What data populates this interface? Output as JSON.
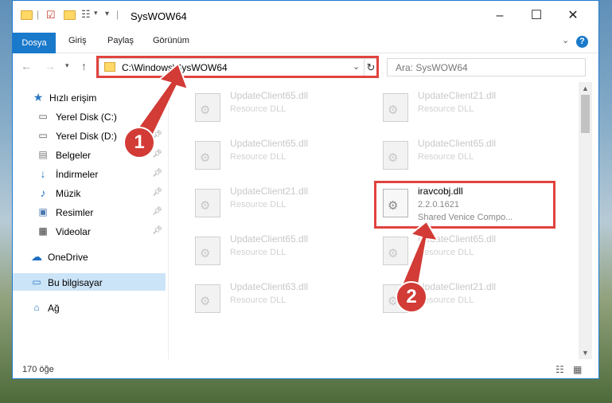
{
  "window": {
    "title": "SysWOW64"
  },
  "ribbon": {
    "tabs": [
      "Dosya",
      "Giriş",
      "Paylaş",
      "Görünüm"
    ]
  },
  "address": {
    "path": "C:\\Windows\\SysWOW64"
  },
  "search": {
    "placeholder": "Ara: SysWOW64"
  },
  "sidebar": {
    "quick_access": "Hızlı erişim",
    "items": [
      "Yerel Disk (C:)",
      "Yerel Disk (D:)",
      "Belgeler",
      "İndirmeler",
      "Müzik",
      "Resimler",
      "Videolar"
    ],
    "onedrive": "OneDrive",
    "this_pc": "Bu bilgisayar",
    "network": "Ağ"
  },
  "files": [
    {
      "name": "UpdateClient65.dll",
      "desc": "Resource DLL"
    },
    {
      "name": "UpdateClient21.dll",
      "desc": "Resource DLL"
    },
    {
      "name": "UpdateClient65.dll",
      "desc": "Resource DLL"
    },
    {
      "name": "UpdateClient65.dll",
      "desc": "Resource DLL"
    },
    {
      "name": "UpdateClient21.dll",
      "desc": "Resource DLL"
    },
    {
      "name": "iravcobj.dll",
      "version": "2.2.0.1621",
      "desc": "Shared Venice Compo..."
    },
    {
      "name": "UpdateClient65.dll",
      "desc": "Resource DLL"
    },
    {
      "name": "UpdateClient65.dll",
      "desc": "Resource DLL"
    },
    {
      "name": "UpdateClient63.dll",
      "desc": "Resource DLL"
    },
    {
      "name": "UpdateClient21.dll",
      "desc": "Resource DLL"
    }
  ],
  "status": {
    "count": "170 öğe"
  },
  "callouts": {
    "step1": "1",
    "step2": "2"
  },
  "colors": {
    "accent": "#1979ca",
    "callout": "#e0433f",
    "badge": "#d23b36"
  }
}
